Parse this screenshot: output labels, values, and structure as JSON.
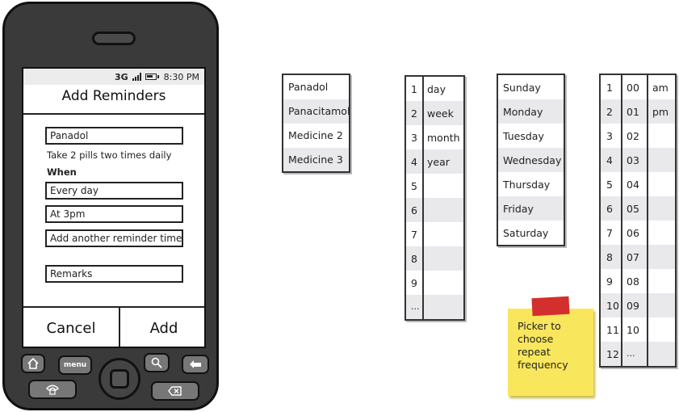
{
  "phone": {
    "status": {
      "network": "3G",
      "time": "8:30 PM"
    },
    "title": "Add Reminders",
    "medicine_field": {
      "value": "Panadol"
    },
    "dosage_text": "Take 2 pills two times daily",
    "when_label": "When",
    "frequency_field": {
      "value": "Every day"
    },
    "time_field": {
      "value": "At 3pm"
    },
    "add_time_field": {
      "value": "Add another reminder time"
    },
    "remarks_field": {
      "placeholder": "Remarks"
    },
    "cancel_label": "Cancel",
    "add_label": "Add",
    "keys": {
      "menu_label": "menu"
    }
  },
  "medicine_picker": {
    "items": [
      "Panadol",
      "Panacitamol",
      "Medicine 2",
      "Medicine 3"
    ]
  },
  "frequency_picker": {
    "numbers": [
      "1",
      "2",
      "3",
      "4",
      "5",
      "6",
      "7",
      "8",
      "9",
      "..."
    ],
    "units": [
      "day",
      "week",
      "month",
      "year"
    ]
  },
  "day_picker": {
    "items": [
      "Sunday",
      "Monday",
      "Tuesday",
      "Wednesday",
      "Thursday",
      "Friday",
      "Saturday"
    ]
  },
  "time_picker": {
    "hours": [
      "1",
      "2",
      "3",
      "4",
      "5",
      "6",
      "7",
      "8",
      "9",
      "10",
      "11",
      "12"
    ],
    "minutes": [
      "00",
      "01",
      "02",
      "03",
      "04",
      "05",
      "06",
      "07",
      "08",
      "09",
      "10",
      "..."
    ],
    "ampm": [
      "am",
      "pm"
    ]
  },
  "sticky_note": {
    "text": "Picker to choose repeat frequency"
  },
  "colors": {
    "phone_body": "#3a3a3a",
    "sticky": "#f8e65c",
    "tape": "#d32f2f",
    "alt_row": "#e9e9ec"
  },
  "icons": [
    "home-icon",
    "menu-key-icon",
    "search-icon",
    "back-arrow-icon",
    "call-icon",
    "delete-icon"
  ]
}
